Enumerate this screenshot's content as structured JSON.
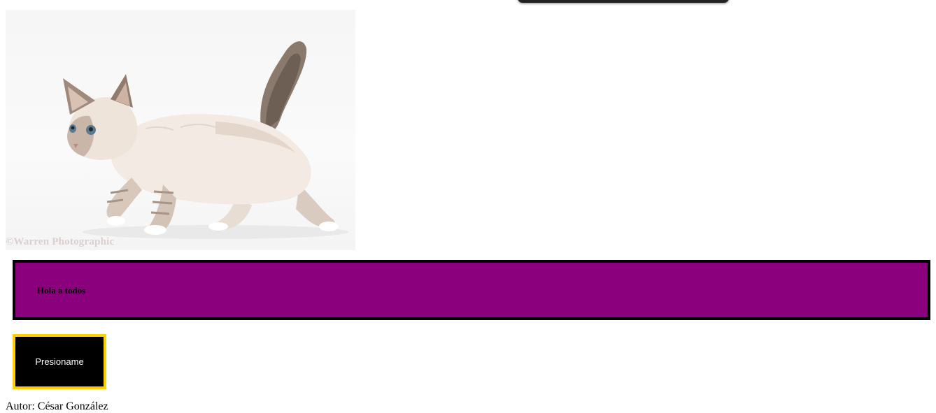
{
  "image": {
    "subject": "kitten-photo",
    "watermark": "©Warren Photographic"
  },
  "banner": {
    "text": "Hola a todos",
    "background": "#8b007d",
    "border": "#000000"
  },
  "button": {
    "label": "Presioname",
    "background": "#000000",
    "border": "#ffd000",
    "text_color": "#ffffff"
  },
  "footer": {
    "author": "Autor: César González"
  }
}
